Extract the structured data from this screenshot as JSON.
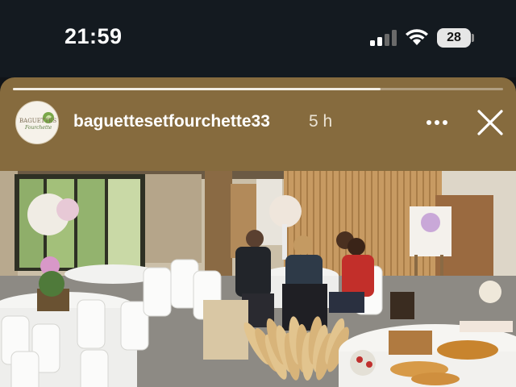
{
  "status_bar": {
    "time": "21:59",
    "battery": "28",
    "icons": [
      "cellular-signal-icon",
      "wifi-icon",
      "battery-icon"
    ]
  },
  "story": {
    "progress": 0.75,
    "username": "baguettesetfourchette33",
    "time_ago": "5 h",
    "avatar_logo": {
      "line1": "BAGUETTES ET",
      "line2": "Fourchette"
    },
    "controls": [
      "more-options-icon",
      "close-icon"
    ]
  },
  "colors": {
    "status_bar_bg": "#141a20",
    "story_bg": "#866b3e",
    "text": "#ffffff"
  }
}
